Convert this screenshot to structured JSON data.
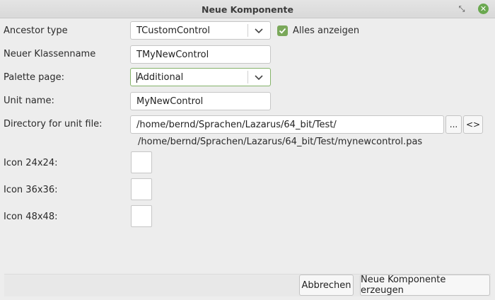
{
  "window": {
    "title": "Neue Komponente",
    "restore_icon": "restore-icon",
    "close_icon": "close-icon",
    "close_glyph": "✕"
  },
  "form": {
    "ancestor_type": {
      "label": "Ancestor type",
      "value": "TCustomControl"
    },
    "show_all": {
      "label": "Alles anzeigen",
      "checked": true
    },
    "class_name": {
      "label": "Neuer Klassenname",
      "value": "TMyNewControl"
    },
    "palette_page": {
      "label": "Palette page:",
      "value": "Additional"
    },
    "unit_name": {
      "label": "Unit name:",
      "value": "MyNewControl"
    },
    "directory": {
      "label": "Directory for unit file:",
      "value": "/home/bernd/Sprachen/Lazarus/64_bit/Test/",
      "browse_label": "...",
      "swap_label": "<>",
      "full_path": "/home/bernd/Sprachen/Lazarus/64_bit/Test/mynewcontrol.pas"
    },
    "icons": [
      {
        "label": "Icon 24x24:"
      },
      {
        "label": "Icon 36x36:"
      },
      {
        "label": "Icon 48x48:"
      }
    ]
  },
  "buttons": {
    "cancel": "Abbrechen",
    "create": "Neue Komponente erzeugen"
  },
  "colors": {
    "accent": "#7aa85a",
    "close": "#6aa84f"
  }
}
